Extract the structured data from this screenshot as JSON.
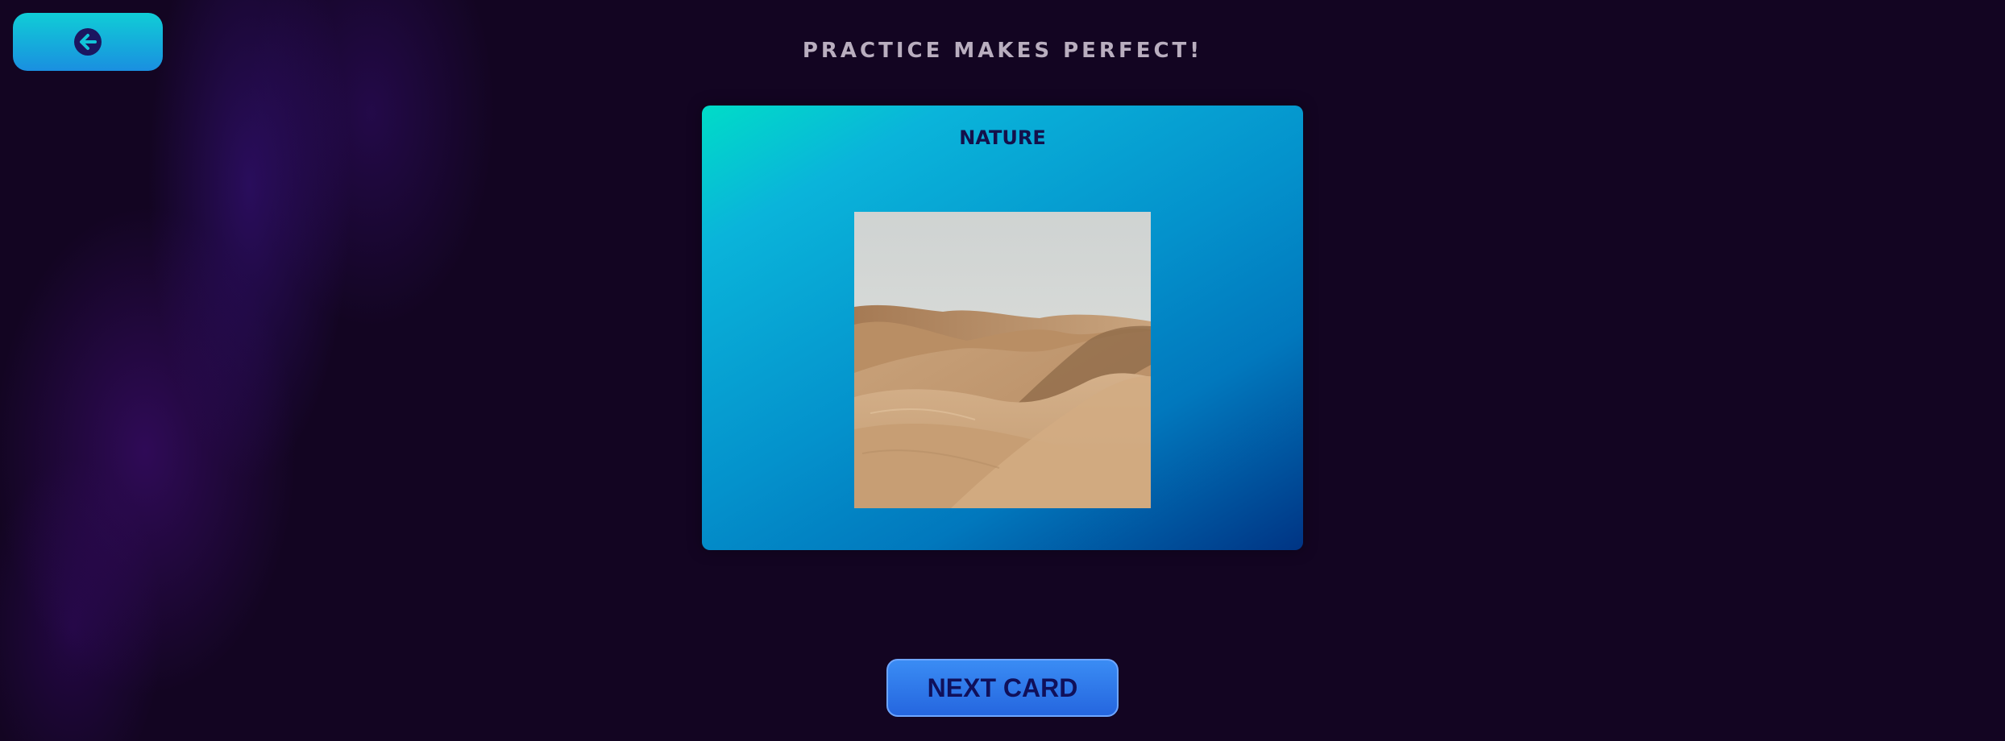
{
  "header": {
    "back_icon": "arrow-left-circle-icon",
    "title": "PRACTICE MAKES PERFECT!"
  },
  "card": {
    "category": "NATURE",
    "image_subject": "desert sand dunes"
  },
  "footer": {
    "next_label": "NEXT CARD"
  },
  "colors": {
    "background": "#130522",
    "accent_teal": "#10cdd6",
    "accent_blue": "#2566df",
    "title_text": "#b9aebf",
    "dark_text": "#14104a"
  }
}
